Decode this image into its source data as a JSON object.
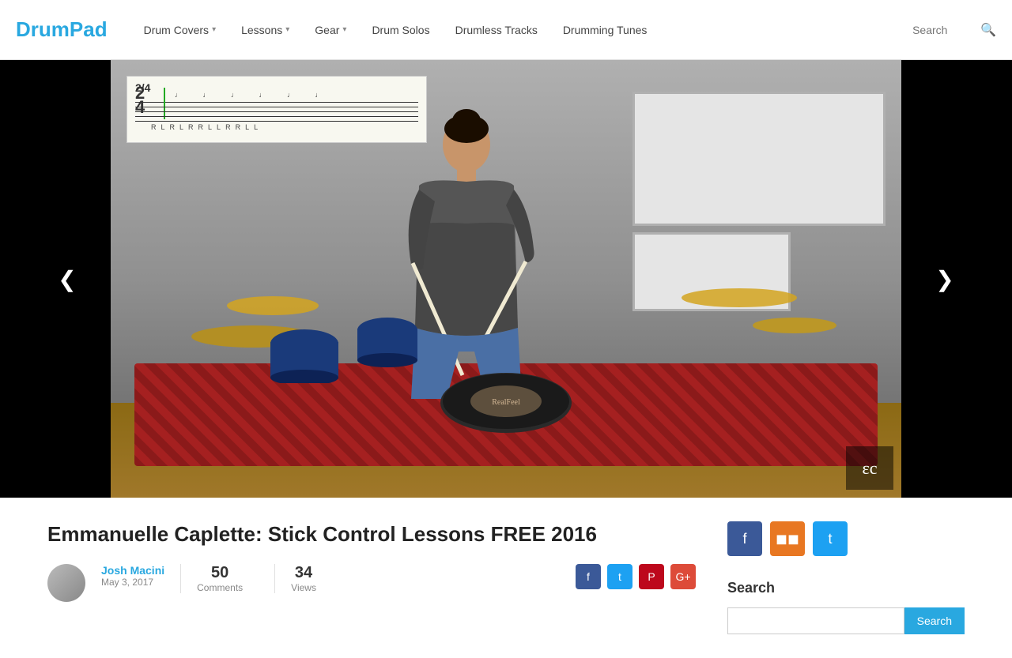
{
  "header": {
    "logo": {
      "drum": "Drum",
      "pad": "Pad"
    },
    "nav": [
      {
        "label": "Drum Covers",
        "hasDropdown": true
      },
      {
        "label": "Lessons",
        "hasDropdown": true
      },
      {
        "label": "Gear",
        "hasDropdown": true
      },
      {
        "label": "Drum Solos",
        "hasDropdown": false
      },
      {
        "label": "Drumless Tracks",
        "hasDropdown": false
      },
      {
        "label": "Drumming Tunes",
        "hasDropdown": false
      }
    ],
    "search": {
      "placeholder": "Search",
      "icon": "🔍"
    }
  },
  "slider": {
    "prev_label": "❮",
    "next_label": "❯",
    "sheet_music": {
      "time_sig": "2/4",
      "rl_letters": [
        "R",
        "L",
        "R",
        "L",
        "R",
        "R",
        "L",
        "L",
        "R",
        "R",
        "L",
        "L"
      ]
    },
    "ec_watermark": "ɛc"
  },
  "article": {
    "title": "Emmanuelle Caplette: Stick Control Lessons FREE 2016",
    "author": {
      "name": "Josh Macini",
      "date": "May 3, 2017"
    },
    "stats": [
      {
        "number": "50",
        "label": "Comments"
      },
      {
        "number": "34",
        "label": "Views"
      }
    ],
    "share_buttons": [
      {
        "icon": "f",
        "platform": "facebook"
      },
      {
        "icon": "t",
        "platform": "twitter"
      },
      {
        "icon": "P",
        "platform": "pinterest"
      },
      {
        "icon": "G+",
        "platform": "google-plus"
      }
    ]
  },
  "sidebar": {
    "social_buttons": [
      {
        "icon": "f",
        "label": "Facebook",
        "type": "facebook"
      },
      {
        "icon": "⊞",
        "label": "RSS",
        "type": "rss"
      },
      {
        "icon": "t",
        "label": "Twitter",
        "type": "twitter"
      }
    ],
    "search": {
      "title": "Search",
      "placeholder": "",
      "button_label": "Search"
    }
  }
}
